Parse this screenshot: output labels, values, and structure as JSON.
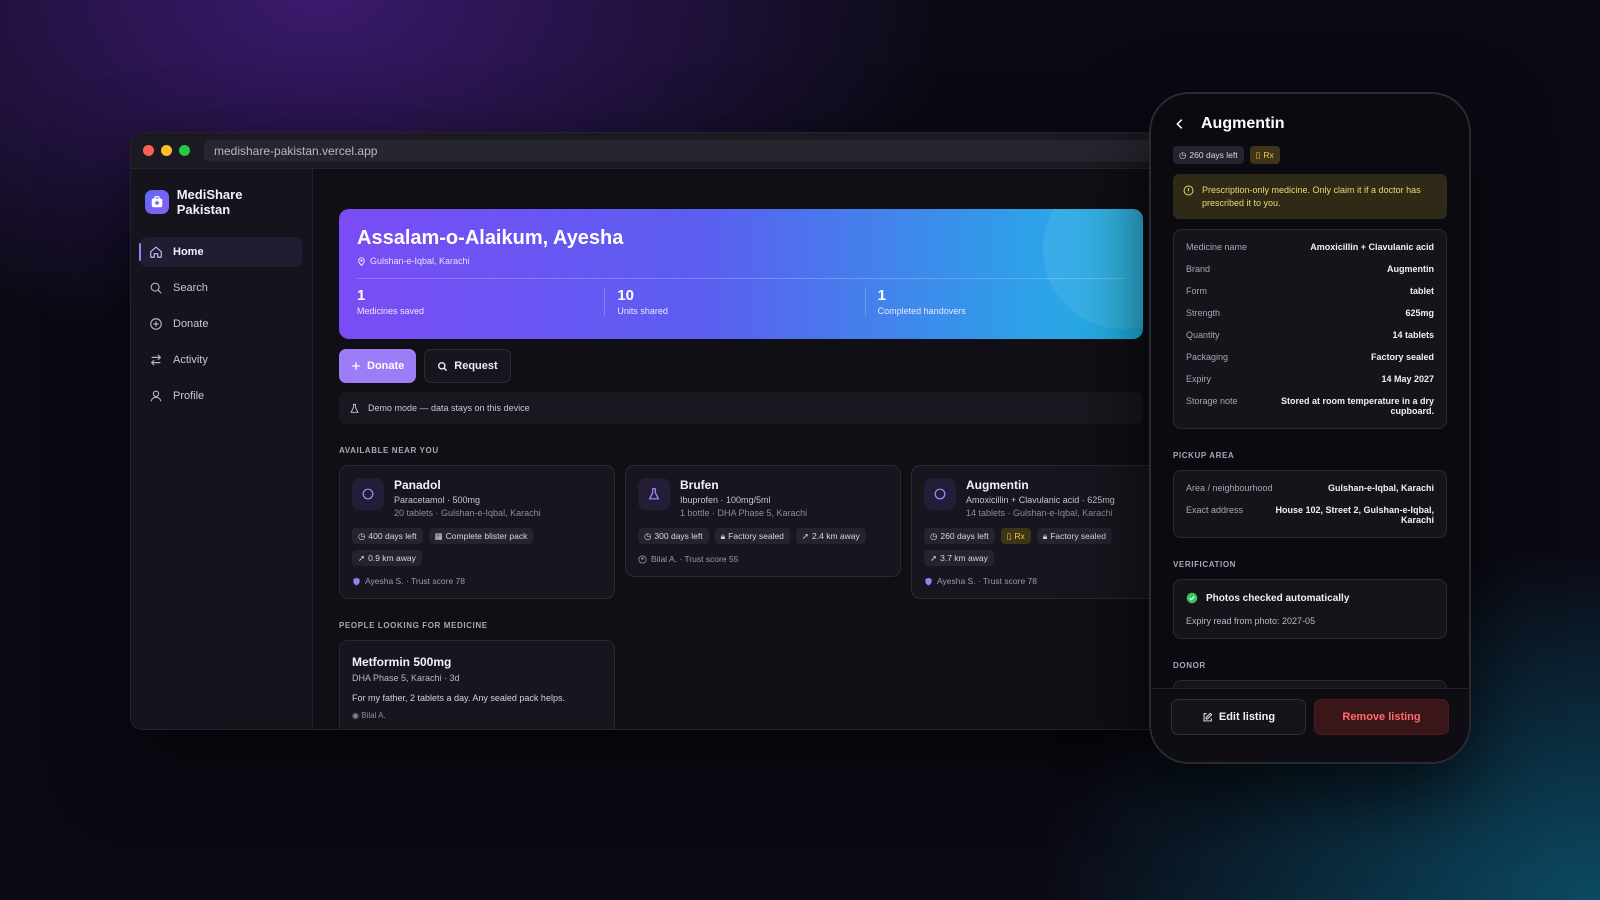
{
  "browser": {
    "url": "medishare-pakistan.vercel.app"
  },
  "colors": {
    "accent": "#9d7cf8",
    "rx": "#f5c94a",
    "danger": "#ff6b6b",
    "success": "#34c759"
  },
  "sidebar": {
    "brand": "MediShare Pakistan",
    "items": [
      {
        "label": "Home",
        "icon": "home-icon",
        "active": true
      },
      {
        "label": "Search",
        "icon": "search-icon"
      },
      {
        "label": "Donate",
        "icon": "plus-circle-icon"
      },
      {
        "label": "Activity",
        "icon": "swap-icon"
      },
      {
        "label": "Profile",
        "icon": "user-icon"
      }
    ]
  },
  "hero": {
    "greeting": "Assalam-o-Alaikum, Ayesha",
    "location": "Gulshan-e-Iqbal, Karachi",
    "stats": [
      {
        "value": "1",
        "label": "Medicines saved"
      },
      {
        "value": "10",
        "label": "Units shared"
      },
      {
        "value": "1",
        "label": "Completed handovers"
      }
    ]
  },
  "actions": {
    "donate": "Donate",
    "request": "Request"
  },
  "demo_notice": "Demo mode — data stays on this device",
  "available": {
    "title": "AVAILABLE NEAR YOU",
    "cards": [
      {
        "name": "Panadol",
        "generic": "Paracetamol · 500mg",
        "detail": "20 tablets · Gulshan-e-Iqbal, Karachi",
        "chips": [
          "400 days left",
          "Complete blister pack",
          "0.9 km away"
        ],
        "donor": "Ayesha S. · Trust score 78"
      },
      {
        "name": "Brufen",
        "generic": "Ibuprofen · 100mg/5ml",
        "detail": "1 bottle · DHA Phase 5, Karachi",
        "chips": [
          "300 days left",
          "Factory sealed",
          "2.4 km away"
        ],
        "donor": "Bilal A. · Trust score 55"
      },
      {
        "name": "Augmentin",
        "generic": "Amoxicillin + Clavulanic acid · 625mg",
        "detail": "14 tablets · Gulshan-e-Iqbal, Karachi",
        "chips": [
          "260 days left",
          "Rx",
          "Factory sealed",
          "3.7 km away"
        ],
        "donor": "Ayesha S. · Trust score 78"
      }
    ]
  },
  "requests": {
    "title": "PEOPLE LOOKING FOR MEDICINE",
    "items": [
      {
        "name": "Metformin 500mg",
        "meta": "DHA Phase 5, Karachi · 3d",
        "text": "For my father, 2 tablets a day. Any sealed pack helps.",
        "user": "Bilal A."
      }
    ]
  },
  "phone": {
    "title": "Augmentin",
    "badges": [
      "260 days left",
      "Rx"
    ],
    "warning": "Prescription-only medicine. Only claim it if a doctor has prescribed it to you.",
    "details": [
      {
        "k": "Medicine name",
        "v": "Amoxicillin + Clavulanic acid"
      },
      {
        "k": "Brand",
        "v": "Augmentin"
      },
      {
        "k": "Form",
        "v": "tablet"
      },
      {
        "k": "Strength",
        "v": "625mg"
      },
      {
        "k": "Quantity",
        "v": "14 tablets"
      },
      {
        "k": "Packaging",
        "v": "Factory sealed"
      },
      {
        "k": "Expiry",
        "v": "14 May 2027"
      },
      {
        "k": "Storage note",
        "v": "Stored at room temperature in a dry cupboard."
      }
    ],
    "pickup_title": "PICKUP AREA",
    "pickup": [
      {
        "k": "Area / neighbourhood",
        "v": "Gulshan-e-Iqbal, Karachi"
      },
      {
        "k": "Exact address",
        "v": "House 102, Street 2, Gulshan-e-Iqbal, Karachi"
      }
    ],
    "verification_title": "VERIFICATION",
    "verification_check": "Photos checked automatically",
    "verification_expiry": "Expiry read from photo: 2027-05",
    "donor_title": "DONOR",
    "edit": "Edit listing",
    "remove": "Remove listing"
  }
}
